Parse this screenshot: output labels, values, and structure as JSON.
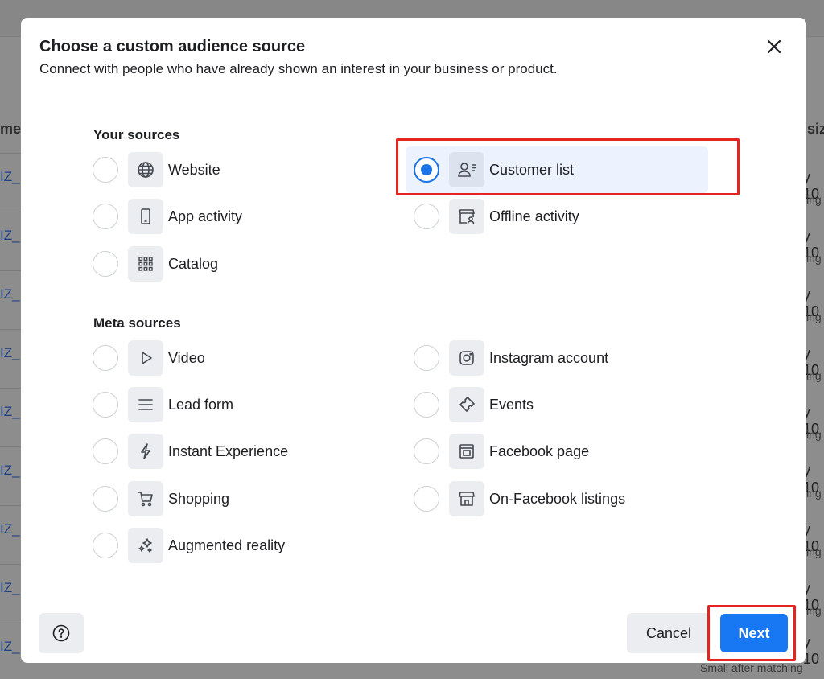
{
  "background": {
    "left_column_header": "me",
    "right_column_header": "siz",
    "row_left_text": "IZ_",
    "row_right_text": "y 10",
    "row_right_sub": "ing",
    "bottom_note": "Small after matching"
  },
  "modal": {
    "title": "Choose a custom audience source",
    "subtitle": "Connect with people who have already shown an interest in your business or product.",
    "close_label": "×"
  },
  "your_sources": {
    "heading": "Your sources",
    "items": [
      {
        "label": "Website",
        "icon": "globe-icon",
        "selected": false
      },
      {
        "label": "Customer list",
        "icon": "person-list-icon",
        "selected": true
      },
      {
        "label": "App activity",
        "icon": "phone-icon",
        "selected": false
      },
      {
        "label": "Offline activity",
        "icon": "store-person-icon",
        "selected": false
      },
      {
        "label": "Catalog",
        "icon": "grid-icon",
        "selected": false
      }
    ]
  },
  "meta_sources": {
    "heading": "Meta sources",
    "items": [
      {
        "label": "Video",
        "icon": "play-icon"
      },
      {
        "label": "Instagram account",
        "icon": "instagram-icon"
      },
      {
        "label": "Lead form",
        "icon": "lines-icon"
      },
      {
        "label": "Events",
        "icon": "ticket-icon"
      },
      {
        "label": "Instant Experience",
        "icon": "bolt-icon"
      },
      {
        "label": "Facebook page",
        "icon": "page-icon"
      },
      {
        "label": "Shopping",
        "icon": "cart-icon"
      },
      {
        "label": "On-Facebook listings",
        "icon": "storefront-icon"
      },
      {
        "label": "Augmented reality",
        "icon": "sparkles-icon"
      }
    ]
  },
  "footer": {
    "help_icon": "question-icon",
    "cancel_label": "Cancel",
    "next_label": "Next"
  },
  "colors": {
    "accent": "#1877f2",
    "radio_selected": "#1a73e8",
    "highlight": "#e5231f",
    "selected_bg": "#ecf3ff"
  }
}
